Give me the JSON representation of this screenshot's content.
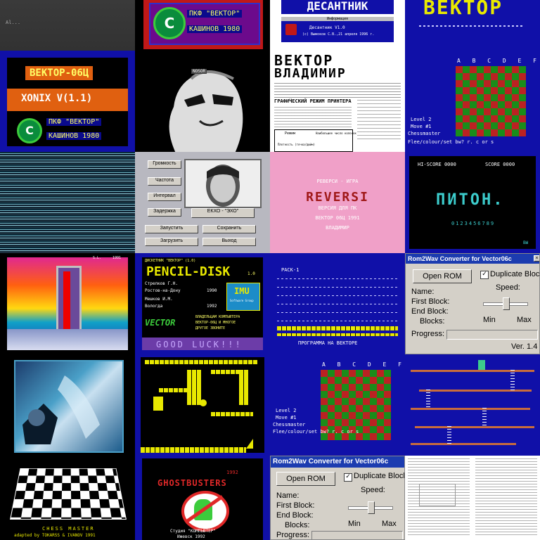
{
  "tiles": {
    "r0c0": {
      "caption": "Al..."
    },
    "r0c1": {
      "badge": "ПКФ \"ВЕКТОР\"",
      "footer": "КАШИНОВ 1980",
      "logo": "C"
    },
    "r0c2": {
      "title": "ДЕСАНТНИК",
      "panel_title": "Информация",
      "line1": "Десантник V1.0",
      "line2": "(с) Вымоков С.В.,21 апреля 1996 г."
    },
    "r0c3": {
      "title": "ВЕКТОР"
    },
    "r1c0": {
      "title": "ВЕКТОР-06Ц",
      "game": "XONIX V(1.1)",
      "badge": "ПКФ \"ВЕКТОР\"",
      "footer": "КАШИНОВ 1980",
      "logo": "C"
    },
    "r1c1": {
      "tag": "NOSOR"
    },
    "r1c2": {
      "title1": "ВЕКТОР",
      "title2": "ВЛАДИМИР",
      "heading": "ГРАФИЧЕСКИЙ РЕЖИМ ПРИНТЕРА",
      "table_h1": "Режим",
      "table_h2": "Наибольшее число колонок",
      "table_r1": "Плотность (точка/дюйм)"
    },
    "r1c3": {
      "files": "A B C D E F G H",
      "level": "Level 2",
      "move": "Move #1",
      "player": "Chessmaster",
      "help": "Flee/colour/set bw? r. c or s"
    },
    "r2c1": {
      "row1_label": "Громкость",
      "row2_label": "Частота",
      "row3_label": "Интервал",
      "row4_label": "Задержка",
      "btn1": "Запустить",
      "btn2": "Сохранить",
      "btn3": "Загрузить",
      "btn4": "Выход",
      "name": "ЕКХО - \"ЭХО\""
    },
    "r2c2": {
      "line1": "РЕВЕРСИ - ИГРА",
      "line2": "REVERSI",
      "line3": "ВЕРСИЯ ДЛЯ ПК",
      "line4": "ВЕКТОР 06Ц 1991",
      "line5": "ВЛАДИМИР"
    },
    "r2c3": {
      "hiscore_label": "HI-SCORE",
      "hiscore": "0000",
      "score_label": "SCORE",
      "score": "0000",
      "title": "ПИТОН.",
      "digits": "0123456789",
      "corner": "ВЫ"
    },
    "r3c0": {
      "top_left": "S.L.",
      "top_right": "1991"
    },
    "r3c1": {
      "header": "ДИСКЕТНИК \"ВЕКТОР\" (1.0)",
      "title": "PENCIL-DISK",
      "version": "1.0",
      "author1": "Стрелков Г.Н.",
      "city1": "Ростов-на-Дону",
      "year1": "1990",
      "author2": "Мешков И.М.",
      "city2": "Вологда",
      "year2": "1992",
      "imu": "IMU",
      "imu_sub": "Software Group",
      "promo1": "ВЛАДЕЛЬЦАМ КОМПЬЮТЕРА",
      "promo2": "ВЕКТОР-06Ц И МНОГОЕ",
      "promo3": "ДРУГОЕ ЗВОНИТЕ",
      "vector": "VECTOR",
      "footer": "GOOD LUCK!!!"
    },
    "r3c2": {
      "label": "PACK-1",
      "status": "ПРОГРАММА НА ВЕКТОРЕ"
    },
    "r3c3": {
      "window_title": "Rom2Wav Converter for Vector06c",
      "open_rom": "Open ROM",
      "dup_blocks": "Duplicate Blocks",
      "speed_label": "Speed:",
      "name_label": "Name:",
      "first_block": "First Block:",
      "end_block": "End Block:",
      "blocks": "Blocks:",
      "min": "Min",
      "max": "Max",
      "progress": "Progress:",
      "version": "Ver. 1.4"
    },
    "r4c3": {
      "files": "A B C D E F G H",
      "level": "Level 2",
      "move": "Move #1",
      "player": "Chessmaster",
      "help": "Flee/colour/set bw? r. c or s"
    },
    "r5c0": {
      "title": "CHESS MASTER",
      "credit": "adapted by TOKARSS & IVANOV 1991"
    },
    "r5c1": {
      "year": "1992",
      "title": "GHOSTBUSTERS",
      "studio": "Студия \"КОМПЬЮТЕР\"",
      "city": "Ижевск 1992"
    },
    "r5c2": {
      "window_title": "Rom2Wav Converter for Vector06c",
      "open_rom": "Open ROM",
      "dup_blocks": "Duplicate Blocks",
      "speed_label": "Speed:",
      "name_label": "Name:",
      "first_block": "First Block:",
      "end_block": "End Block:",
      "blocks": "Blocks:",
      "min": "Min",
      "max": "Max",
      "progress": "Progress:"
    }
  },
  "colors": {
    "vector_blue": "#1010a8",
    "bezel_red": "#c01818",
    "orange": "#e06010",
    "yellow": "#e8e800",
    "gray": "#c0c0c0",
    "pink": "#f0a0c8",
    "win_blue": "#1c3cb0"
  }
}
